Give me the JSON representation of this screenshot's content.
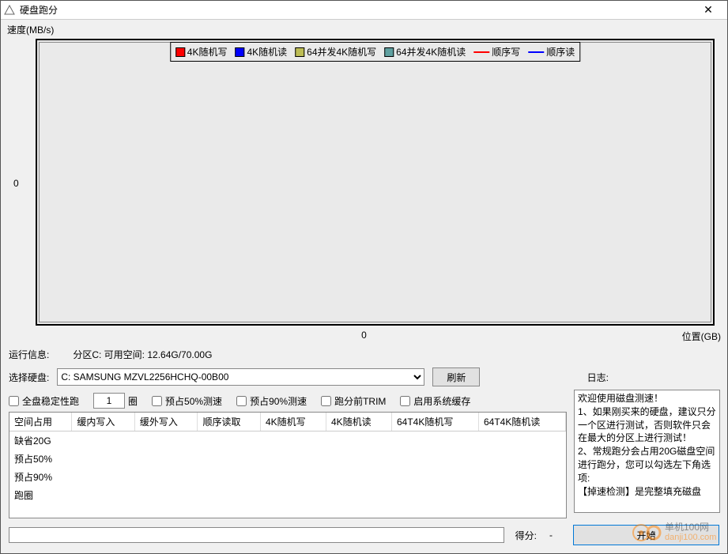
{
  "window": {
    "title": "硬盘跑分",
    "close": "✕"
  },
  "chart_data": {
    "type": "line",
    "title": "",
    "xlabel": "位置(GB)",
    "ylabel": "速度(MB/s)",
    "x_ticks": [
      "0"
    ],
    "y_ticks": [
      "0"
    ],
    "series": [
      {
        "name": "4K随机写",
        "color": "#ff0000",
        "style": "box",
        "values": []
      },
      {
        "name": "4K随机读",
        "color": "#0000ff",
        "style": "box",
        "values": []
      },
      {
        "name": "64并发4K随机写",
        "color": "#9a9a00",
        "style": "box",
        "values": []
      },
      {
        "name": "64并发4K随机读",
        "color": "#008080",
        "style": "box",
        "values": []
      },
      {
        "name": "顺序写",
        "color": "#ff0000",
        "style": "line",
        "values": []
      },
      {
        "name": "顺序读",
        "color": "#0000ff",
        "style": "line",
        "values": []
      }
    ]
  },
  "info": {
    "label": "运行信息:",
    "text": "分区C: 可用空间: 12.64G/70.00G"
  },
  "disk": {
    "label": "选择硬盘:",
    "selected": "C: SAMSUNG MZVL2256HCHQ-00B00",
    "refresh": "刷新"
  },
  "log_label": "日志:",
  "options": {
    "cb1": "全盘稳定性跑",
    "loop_value": "1",
    "loop_unit": "圈",
    "cb2": "预占50%测速",
    "cb3": "预占90%测速",
    "cb4": "跑分前TRIM",
    "cb5": "启用系统缓存"
  },
  "table": {
    "headers": [
      "空间占用",
      "缓内写入",
      "缓外写入",
      "顺序读取",
      "4K随机写",
      "4K随机读",
      "64T4K随机写",
      "64T4K随机读"
    ],
    "rows": [
      {
        "label": "缺省20G"
      },
      {
        "label": "预占50%"
      },
      {
        "label": "预占90%"
      },
      {
        "label": "跑圈"
      }
    ]
  },
  "log": {
    "lines": [
      "欢迎使用磁盘测速！",
      "1、如果刚买来的硬盘，建议只分一个区进行测试，否则软件只会在最大的分区上进行测试！",
      "2、常规跑分会占用20G磁盘空间进行跑分，您可以勾选左下角选项:",
      "【掉速检测】是完整填充磁盘"
    ]
  },
  "score": {
    "label": "得分:",
    "value": "-"
  },
  "start_label": "开始",
  "watermark": {
    "line1": "单机100网",
    "line2": "danji100.com"
  }
}
